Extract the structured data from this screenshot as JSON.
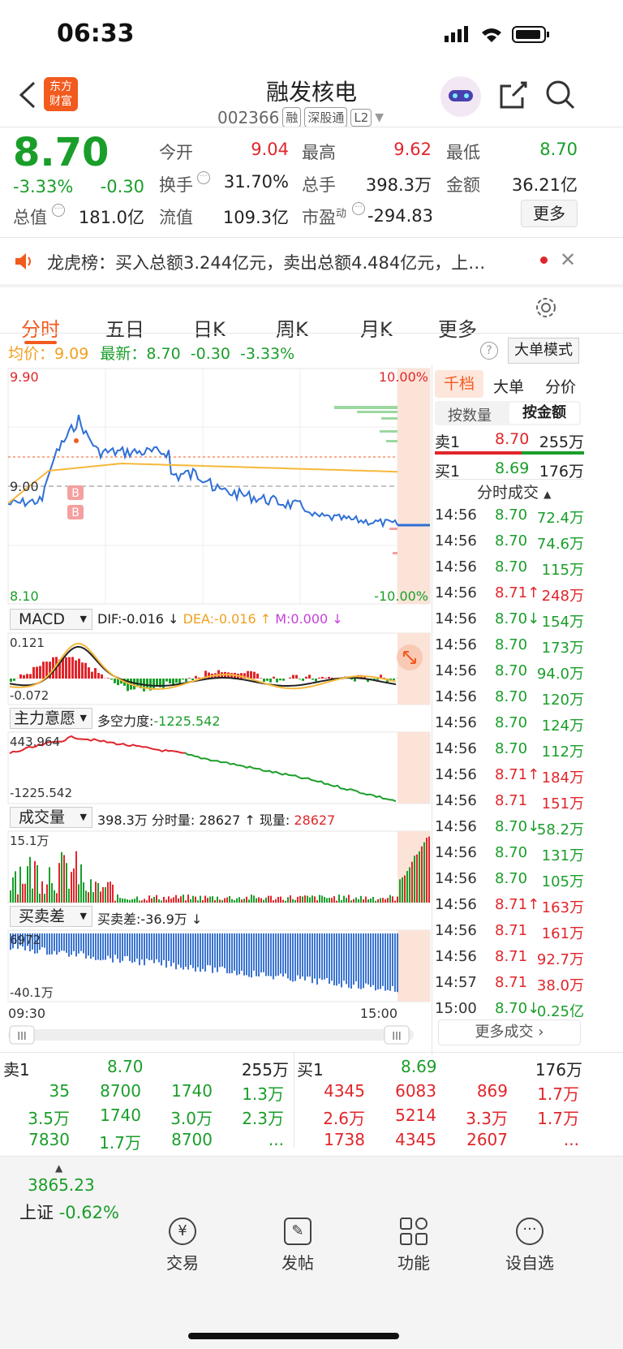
{
  "status": {
    "time": "06:33"
  },
  "header": {
    "title": "融发核电",
    "code": "002366",
    "tag1": "融",
    "tag2": "深股通",
    "tag3": "L2",
    "logo": "东方\n财富"
  },
  "quote": {
    "price": "8.70",
    "pct": "-3.33%",
    "chg": "-0.30",
    "open_lbl": "今开",
    "open": "9.04",
    "high_lbl": "最高",
    "high": "9.62",
    "low_lbl": "最低",
    "low": "8.70",
    "turnover_lbl": "换手",
    "turnover": "31.70%",
    "vol_lbl": "总手",
    "vol": "398.3万",
    "amount_lbl": "金额",
    "amount": "36.21亿",
    "mcap_lbl": "总值",
    "mcap": "181.0亿",
    "float_lbl": "流值",
    "float": "109.3亿",
    "pe_lbl": "市盈",
    "pe_sup": "动",
    "pe": "-294.83",
    "more": "更多"
  },
  "notice": {
    "text": "龙虎榜：买入总额3.244亿元，卖出总额4.484亿元，上…"
  },
  "tabs": [
    "分时",
    "五日",
    "日K",
    "周K",
    "月K",
    "更多"
  ],
  "chart_info": {
    "avg_lbl": "均价：",
    "avg": "9.09",
    "latest_lbl": "最新：",
    "latest": "8.70",
    "chg": "-0.30",
    "pct": "-3.33%",
    "big_mode": "大单模式"
  },
  "chart_axis": {
    "top": "9.90",
    "mid": "9.00",
    "bottom": "8.10",
    "top_pct": "10.00%",
    "bottom_pct": "-10.00%",
    "t_start": "09:30",
    "t_end": "15:00",
    "b1": "B",
    "b2": "B"
  },
  "macd": {
    "label": "MACD",
    "dif": "DIF:-0.016 ↓",
    "dea": "DEA:-0.016 ↑",
    "m": "M:0.000 ↓",
    "max": "0.121",
    "min": "-0.072"
  },
  "zlyy": {
    "label": "主力意愿",
    "value_lbl": "多空力度:",
    "value": "-1225.542",
    "max": "443.964",
    "min": "-1225.542"
  },
  "vol_ind": {
    "label": "成交量",
    "total": "398.3万",
    "fen_lbl": "分时量:",
    "fen": "28627 ↑",
    "xian_lbl": "现量:",
    "xian": "28627",
    "max": "15.1万"
  },
  "mmc": {
    "label": "买卖差",
    "value": "买卖差:-36.9万 ↓",
    "max": "6972",
    "min": "-40.1万"
  },
  "side": {
    "tabs": [
      "千档",
      "大单",
      "分价"
    ],
    "mode": [
      "按数量",
      "按金额"
    ],
    "sell1": {
      "lbl": "卖1",
      "price": "8.70",
      "amt": "255万"
    },
    "buy1": {
      "lbl": "买1",
      "price": "8.69",
      "amt": "176万"
    },
    "trades_title": "分时成交",
    "trades": [
      {
        "t": "14:56",
        "p": "8.70",
        "a": "72.4万",
        "c": "g",
        "d": ""
      },
      {
        "t": "14:56",
        "p": "8.70",
        "a": "74.6万",
        "c": "g",
        "d": ""
      },
      {
        "t": "14:56",
        "p": "8.70",
        "a": "115万",
        "c": "g",
        "d": ""
      },
      {
        "t": "14:56",
        "p": "8.71",
        "a": "248万",
        "c": "r",
        "d": "↑"
      },
      {
        "t": "14:56",
        "p": "8.70",
        "a": "154万",
        "c": "g",
        "d": "↓"
      },
      {
        "t": "14:56",
        "p": "8.70",
        "a": "173万",
        "c": "g",
        "d": ""
      },
      {
        "t": "14:56",
        "p": "8.70",
        "a": "94.0万",
        "c": "g",
        "d": ""
      },
      {
        "t": "14:56",
        "p": "8.70",
        "a": "120万",
        "c": "g",
        "d": ""
      },
      {
        "t": "14:56",
        "p": "8.70",
        "a": "124万",
        "c": "g",
        "d": ""
      },
      {
        "t": "14:56",
        "p": "8.70",
        "a": "112万",
        "c": "g",
        "d": ""
      },
      {
        "t": "14:56",
        "p": "8.71",
        "a": "184万",
        "c": "r",
        "d": "↑"
      },
      {
        "t": "14:56",
        "p": "8.71",
        "a": "151万",
        "c": "r",
        "d": ""
      },
      {
        "t": "14:56",
        "p": "8.70",
        "a": "58.2万",
        "c": "g",
        "d": "↓"
      },
      {
        "t": "14:56",
        "p": "8.70",
        "a": "131万",
        "c": "g",
        "d": ""
      },
      {
        "t": "14:56",
        "p": "8.70",
        "a": "105万",
        "c": "g",
        "d": ""
      },
      {
        "t": "14:56",
        "p": "8.71",
        "a": "163万",
        "c": "r",
        "d": "↑"
      },
      {
        "t": "14:56",
        "p": "8.71",
        "a": "161万",
        "c": "r",
        "d": ""
      },
      {
        "t": "14:56",
        "p": "8.71",
        "a": "92.7万",
        "c": "r",
        "d": ""
      },
      {
        "t": "14:57",
        "p": "8.71",
        "a": "38.0万",
        "c": "r",
        "d": ""
      },
      {
        "t": "15:00",
        "p": "8.70",
        "a": "0.25亿",
        "c": "g",
        "d": "↓"
      }
    ],
    "more_trades": "更多成交"
  },
  "orderbook": {
    "sell_lbl": "卖1",
    "sell_price": "8.70",
    "sell_amt": "255万",
    "buy_lbl": "买1",
    "buy_price": "8.69",
    "buy_amt": "176万",
    "sell_rows": [
      [
        "35",
        "8700",
        "1740",
        "1.3万"
      ],
      [
        "3.5万",
        "1740",
        "3.0万",
        "2.3万"
      ],
      [
        "7830",
        "1.7万",
        "8700",
        "..."
      ]
    ],
    "buy_rows": [
      [
        "4345",
        "6083",
        "869",
        "1.7万"
      ],
      [
        "2.6万",
        "5214",
        "3.3万",
        "1.7万"
      ],
      [
        "1738",
        "4345",
        "2607",
        "..."
      ]
    ]
  },
  "bottom": {
    "index_val": "3865.23",
    "index_name": "上证",
    "index_pct": "-0.62%",
    "trade": "交易",
    "post": "发帖",
    "func": "功能",
    "watch": "设自选"
  }
}
